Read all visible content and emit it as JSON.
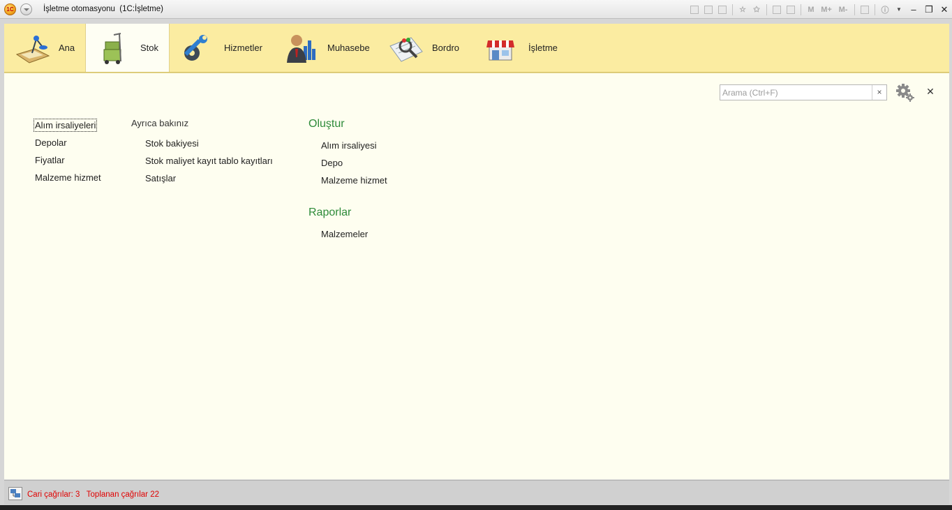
{
  "window": {
    "title": "İşletme otomasyonu  (1C:İşletme)",
    "logo_text": "1C",
    "toolbar_labels": {
      "m": "M",
      "m_plus": "M+",
      "m_minus": "M-"
    },
    "window_controls": {
      "minimize": "‒",
      "restore": "❐",
      "close": "✕"
    }
  },
  "sections": [
    {
      "label": "Ana",
      "icon": "desk-lamp-icon",
      "active": false
    },
    {
      "label": "Stok",
      "icon": "hand-truck-boxes-icon",
      "active": true
    },
    {
      "label": "Hizmetler",
      "icon": "wrench-gear-icon",
      "active": false
    },
    {
      "label": "Muhasebe",
      "icon": "accountant-chart-icon",
      "active": false
    },
    {
      "label": "Bordro",
      "icon": "magnifier-document-icon",
      "active": false
    },
    {
      "label": "İşletme",
      "icon": "storefront-icon",
      "active": false
    }
  ],
  "search": {
    "placeholder": "Arama (Ctrl+F)",
    "value": "",
    "clear_label": "×"
  },
  "panel_close_label": "✕",
  "nav": {
    "items": [
      "Alım irsaliyeleri",
      "Depolar",
      "Fiyatlar",
      "Malzeme hizmet"
    ],
    "see_also_heading": "Ayrıca bakınız",
    "see_also": [
      "Stok bakiyesi",
      "Stok maliyet kayıt tablo kayıtları",
      "Satışlar"
    ]
  },
  "actions": {
    "create_heading": "Oluştur",
    "create": [
      "Alım irsaliyesi",
      "Depo",
      "Malzeme hizmet"
    ],
    "reports_heading": "Raporlar",
    "reports": [
      "Malzemeler"
    ]
  },
  "status": {
    "text": "Cari çağrılar: 3   Toplanan çağrılar 22"
  },
  "colors": {
    "section_bar": "#fbeca1",
    "work_area": "#fefef0",
    "heading_green": "#2e8b3a",
    "status_red": "#e00000"
  }
}
